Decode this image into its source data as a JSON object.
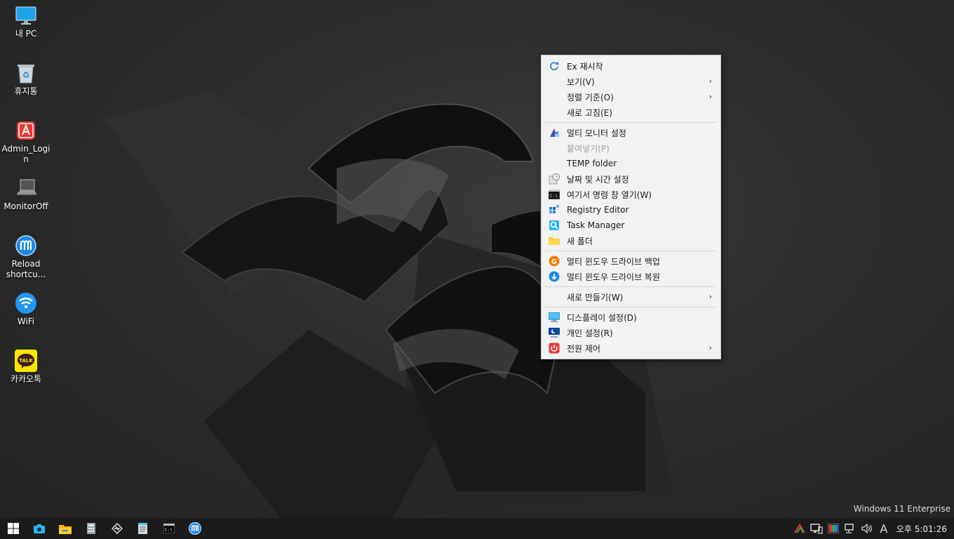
{
  "desktop": {
    "icons": [
      {
        "label": "내 PC",
        "icon": "monitor-icon"
      },
      {
        "label": "휴지통",
        "icon": "recycle-bin-icon"
      },
      {
        "label": "Admin_Login",
        "icon": "admin-login-icon"
      },
      {
        "label": "MonitorOff",
        "icon": "laptop-icon"
      },
      {
        "label": "Reload shortcu...",
        "icon": "reload-m-icon"
      },
      {
        "label": "WiFi",
        "icon": "wifi-icon"
      },
      {
        "label": "카카오톡",
        "icon": "kakaotalk-icon"
      }
    ],
    "kakao_badge": "TALK",
    "edition": "Windows 11 Enterprise"
  },
  "context_menu": {
    "items": [
      {
        "label": "Ex 재시작",
        "icon": "refresh-icon"
      },
      {
        "label": "보기(V)",
        "submenu": true
      },
      {
        "label": "정렬 기준(O)",
        "submenu": true
      },
      {
        "label": "새로 고침(E)"
      },
      {
        "label": "멀티 모니터 설정",
        "icon": "multi-monitor-icon"
      },
      {
        "label": "붙여넣기(P)",
        "disabled": true
      },
      {
        "label": "TEMP folder"
      },
      {
        "label": "날짜 및 시간 설정",
        "icon": "clock-calendar-icon"
      },
      {
        "label": "여기서 명령 창 열기(W)",
        "icon": "cmd-icon"
      },
      {
        "label": "Registry Editor",
        "icon": "registry-icon"
      },
      {
        "label": "Task Manager",
        "icon": "task-manager-icon"
      },
      {
        "label": "새 폴더",
        "icon": "folder-icon"
      },
      {
        "label": "멀티 윈도우 드라이브 백업",
        "icon": "backup-icon"
      },
      {
        "label": "멀티 윈도우 드라이브 복원",
        "icon": "restore-icon"
      },
      {
        "label": "새로 만들기(W)",
        "submenu": true
      },
      {
        "label": "디스플레이 설정(D)",
        "icon": "display-icon"
      },
      {
        "label": "개인 설정(R)",
        "icon": "personalize-icon"
      },
      {
        "label": "전원 제어",
        "icon": "power-icon",
        "submenu": true
      }
    ],
    "cmd_glyph": "C:\\"
  },
  "taskbar": {
    "pinned": [
      "start-icon",
      "camera-icon",
      "file-explorer-icon",
      "calculator-icon",
      "tool-icon",
      "notepad-icon",
      "cmd-icon",
      "reload-m-icon"
    ],
    "cmd_glyph": "C:\\",
    "tray": {
      "ime_label": "A",
      "clock": "오후 5:01:26"
    }
  },
  "colors": {
    "taskbar": "#1b1b1b",
    "menu_bg": "#f2f2f2",
    "accent_blue": "#1e88e5"
  }
}
